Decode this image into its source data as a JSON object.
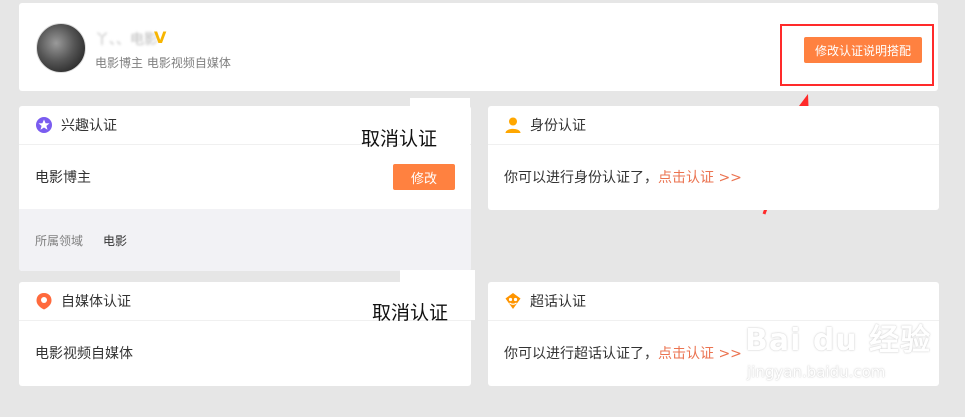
{
  "profile": {
    "name": "丫、、电影",
    "description": "电影博主 电影视频自媒体",
    "verified_mark": "V",
    "edit_button": "修改认证说明搭配"
  },
  "interest_cert": {
    "title": "兴趣认证",
    "item": "电影博主",
    "modify_button": "修改",
    "domain_label": "所属领域",
    "domain_value": "电影"
  },
  "identity_cert": {
    "title": "身份认证",
    "prompt": "你可以进行身份认证了，",
    "link": "点击认证 >>"
  },
  "media_cert": {
    "title": "自媒体认证",
    "item": "电影视频自媒体"
  },
  "topic_cert": {
    "title": "超话认证",
    "prompt": "你可以进行超话认证了，",
    "link": "点击认证 >>"
  },
  "annotations": {
    "cancel_1": "取消认证",
    "cancel_2": "取消认证"
  },
  "watermark": {
    "brand": "Bai du 经验",
    "url": "jingyan.baidu.com"
  },
  "colors": {
    "accent": "#ff8140",
    "link": "#eb7350",
    "highlight_box": "#ff2a2a",
    "background": "#e6e6e6"
  }
}
